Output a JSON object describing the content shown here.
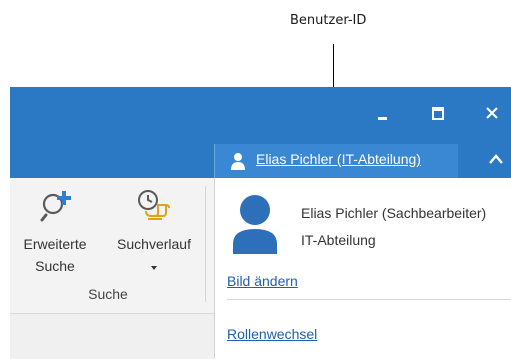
{
  "annotation": {
    "label": "Benutzer-ID"
  },
  "window": {
    "controls": {
      "minimize_icon": "minimize-icon",
      "maximize_icon": "maximize-icon",
      "close_icon": "close-icon"
    },
    "accent_color": "#2b78c5"
  },
  "user_tab": {
    "label": "Elias Pichler (IT-Abteilung)",
    "icon": "person-icon",
    "collapse_icon": "chevron-up-icon"
  },
  "ribbon": {
    "groups": [
      {
        "label": "Suche",
        "buttons": [
          {
            "label_line1": "Erweiterte",
            "label_line2": "Suche",
            "icon": "search-plus-icon"
          },
          {
            "label_line1": "Suchverlauf",
            "icon": "clock-history-icon",
            "has_dropdown": true
          }
        ]
      }
    ]
  },
  "user_panel": {
    "avatar_icon": "avatar-icon",
    "name_role": "Elias Pichler (Sachbearbeiter)",
    "department": "IT-Abteilung",
    "change_picture_link": "Bild ändern",
    "role_switch_link": "Rollenwechsel",
    "link_color": "#1f5fb0"
  }
}
